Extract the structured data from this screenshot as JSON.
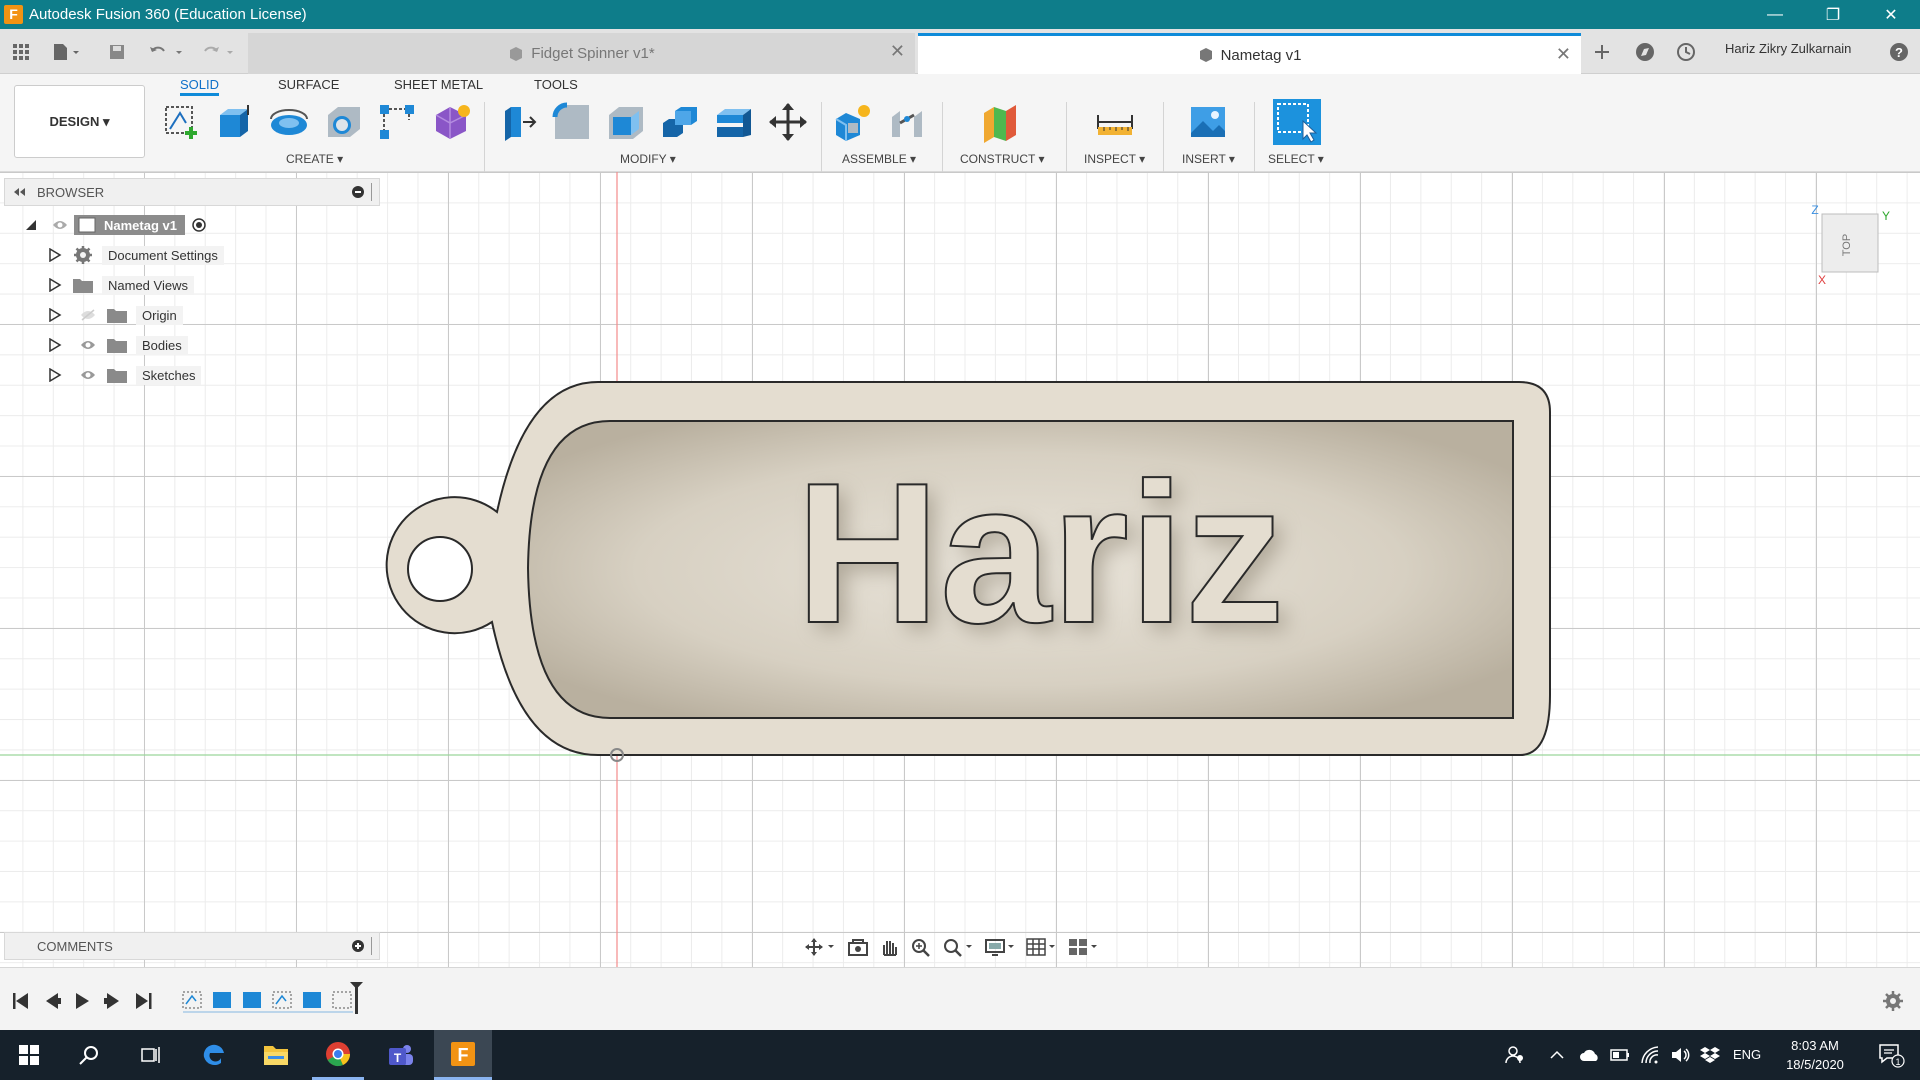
{
  "window": {
    "title": "Autodesk Fusion 360 (Education License)",
    "minimize": "—",
    "maximize": "❐",
    "close": "✕"
  },
  "tabs": [
    {
      "label": "Fidget Spinner v1*",
      "active": false,
      "close": "✕"
    },
    {
      "label": "Nametag v1",
      "active": true,
      "close": "✕"
    }
  ],
  "user": {
    "name": "Hariz Zikry Zulkarnain"
  },
  "toolbar": {
    "workspace": "DESIGN ▾",
    "tabs": [
      "SOLID",
      "SURFACE",
      "SHEET METAL",
      "TOOLS"
    ],
    "groups": [
      "CREATE ▾",
      "MODIFY ▾",
      "ASSEMBLE ▾",
      "CONSTRUCT ▾",
      "INSPECT ▾",
      "INSERT ▾",
      "SELECT ▾"
    ]
  },
  "browser": {
    "title": "BROWSER",
    "items": [
      {
        "label": "Nametag v1"
      },
      {
        "label": "Document Settings"
      },
      {
        "label": "Named Views"
      },
      {
        "label": "Origin"
      },
      {
        "label": "Bodies"
      },
      {
        "label": "Sketches"
      }
    ]
  },
  "comments": {
    "title": "COMMENTS"
  },
  "model": {
    "text": "Hariz"
  },
  "viewcube": {
    "face": "TOP",
    "axis_z": "Z",
    "axis_y": "Y",
    "axis_x": "X"
  },
  "taskbar": {
    "lang": "ENG",
    "time": "8:03 AM",
    "date": "18/5/2020",
    "notif_count": "1"
  },
  "colors": {
    "titlebar": "#0e7d8a",
    "accent": "#0f8bd9",
    "plate": "#e4ddd0",
    "taskbar": "#16212b",
    "fusion_orange": "#f29313"
  }
}
